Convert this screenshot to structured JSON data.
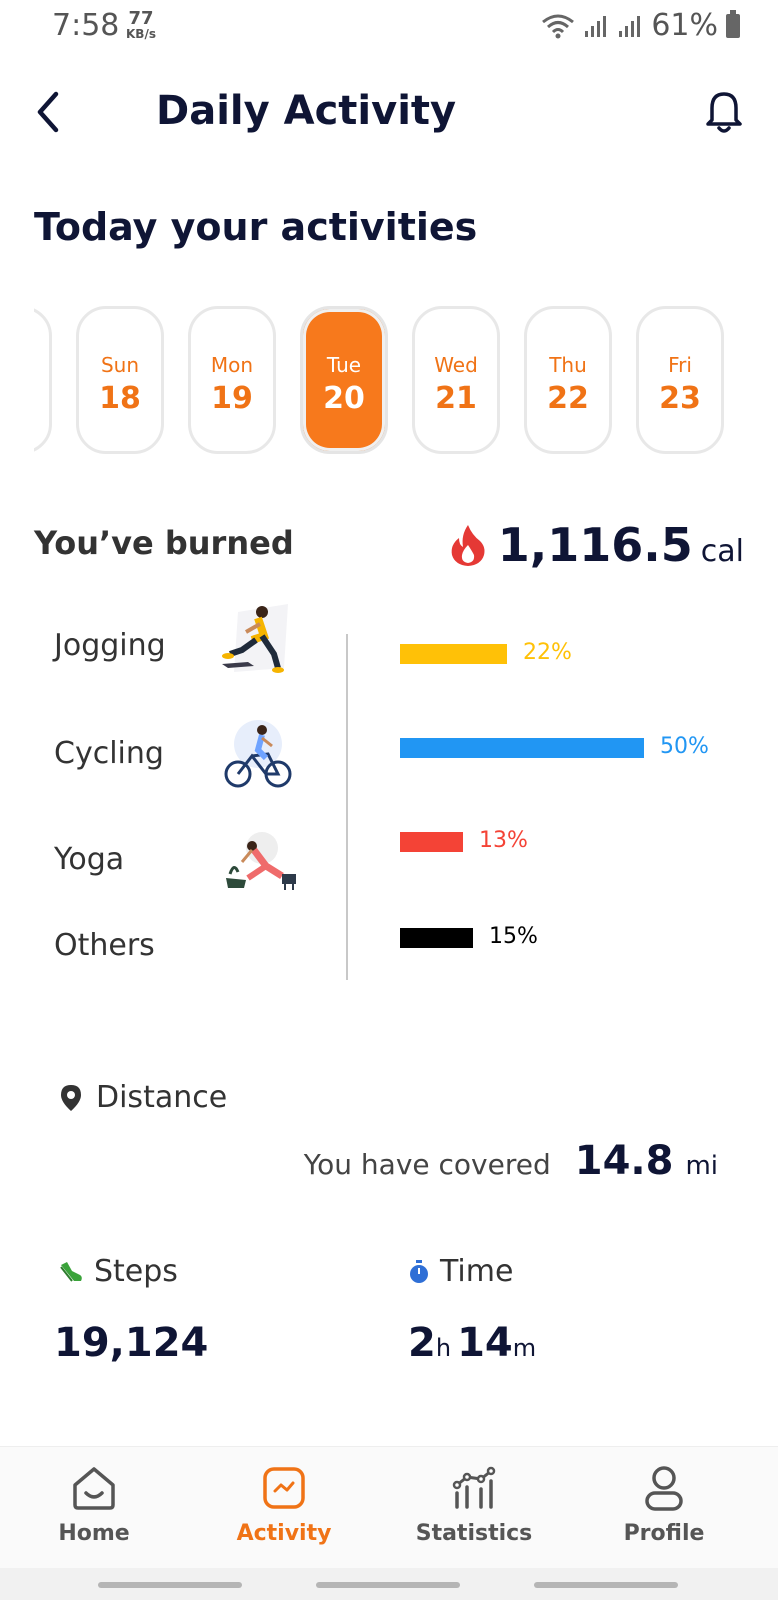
{
  "status": {
    "time": "7:58",
    "kbs_value": "77",
    "kbs_unit": "KB/s",
    "battery": "61%"
  },
  "header": {
    "title": "Daily Activity"
  },
  "section": {
    "title": "Today your activities"
  },
  "days": [
    {
      "name": "Sun",
      "num": "18"
    },
    {
      "name": "Mon",
      "num": "19"
    },
    {
      "name": "Tue",
      "num": "20"
    },
    {
      "name": "Wed",
      "num": "21"
    },
    {
      "name": "Thu",
      "num": "22"
    },
    {
      "name": "Fri",
      "num": "23"
    }
  ],
  "selected_day": "Tue 20",
  "burned": {
    "label": "You’ve burned",
    "value": "1,116.5",
    "unit": "cal"
  },
  "activities": [
    {
      "name": "Jogging",
      "percent_label": "22%",
      "percent": 22,
      "color": "#ffc107"
    },
    {
      "name": "Cycling",
      "percent_label": "50%",
      "percent": 50,
      "color": "#2196f3"
    },
    {
      "name": "Yoga",
      "percent_label": "13%",
      "percent": 13,
      "color": "#f44336"
    },
    {
      "name": "Others",
      "percent_label": "15%",
      "percent": 15,
      "color": "#000000"
    }
  ],
  "distance": {
    "label": "Distance",
    "covered_text": "You have covered",
    "value": "14.8",
    "unit": "mi"
  },
  "steps": {
    "label": "Steps",
    "value": "19,124"
  },
  "time_stat": {
    "label": "Time",
    "hours": "2",
    "h_unit": "h",
    "minutes": "14",
    "m_unit": "m"
  },
  "nav": {
    "home": "Home",
    "activity": "Activity",
    "statistics": "Statistics",
    "profile": "Profile"
  },
  "colors": {
    "accent": "#f7791c",
    "title": "#0f1535"
  }
}
